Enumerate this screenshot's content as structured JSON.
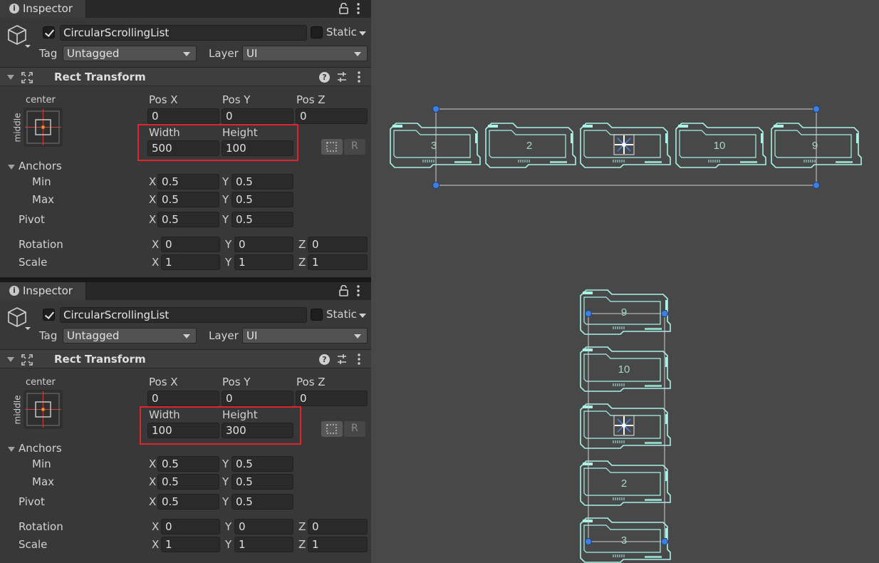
{
  "inspectors": [
    {
      "tab_title": "Inspector",
      "object_name": "CircularScrollingList",
      "static_label": "Static",
      "tag_label": "Tag",
      "tag_value": "Untagged",
      "layer_label": "Layer",
      "layer_value": "UI",
      "component_title": "Rect Transform",
      "anchor_caption": "center",
      "anchor_side": "middle",
      "pos_labels": [
        "Pos X",
        "Pos Y",
        "Pos Z"
      ],
      "pos_values": [
        "0",
        "0",
        "0"
      ],
      "size_labels": [
        "Width",
        "Height"
      ],
      "size_values": [
        "500",
        "100"
      ],
      "anchors_label": "Anchors",
      "min_label": "Min",
      "min_x": "0.5",
      "min_y": "0.5",
      "max_label": "Max",
      "max_x": "0.5",
      "max_y": "0.5",
      "pivot_label": "Pivot",
      "pivot_x": "0.5",
      "pivot_y": "0.5",
      "rotation_label": "Rotation",
      "rotation": [
        "0",
        "0",
        "0"
      ],
      "scale_label": "Scale",
      "scale": [
        "1",
        "1",
        "1"
      ],
      "raw_edit_glyph": "R"
    },
    {
      "tab_title": "Inspector",
      "object_name": "CircularScrollingList",
      "static_label": "Static",
      "tag_label": "Tag",
      "tag_value": "Untagged",
      "layer_label": "Layer",
      "layer_value": "UI",
      "component_title": "Rect Transform",
      "anchor_caption": "center",
      "anchor_side": "middle",
      "pos_labels": [
        "Pos X",
        "Pos Y",
        "Pos Z"
      ],
      "pos_values": [
        "0",
        "0",
        "0"
      ],
      "size_labels": [
        "Width",
        "Height"
      ],
      "size_values": [
        "100",
        "300"
      ],
      "anchors_label": "Anchors",
      "min_label": "Min",
      "min_x": "0.5",
      "min_y": "0.5",
      "max_label": "Max",
      "max_x": "0.5",
      "max_y": "0.5",
      "pivot_label": "Pivot",
      "pivot_x": "0.5",
      "pivot_y": "0.5",
      "rotation_label": "Rotation",
      "rotation": [
        "0",
        "0",
        "0"
      ],
      "scale_label": "Scale",
      "scale": [
        "1",
        "1",
        "1"
      ],
      "raw_edit_glyph": "R"
    }
  ],
  "axis_letters": {
    "x": "X",
    "y": "Y",
    "z": "Z"
  },
  "scene": {
    "horizontal_list": [
      "3",
      "2",
      "",
      "10",
      "9"
    ],
    "vertical_list": [
      "9",
      "10",
      "",
      "2",
      "3"
    ],
    "accent_color": "#a8f3e6",
    "handle_color": "#3d7fe0",
    "highlight_color": "#e0252b"
  }
}
